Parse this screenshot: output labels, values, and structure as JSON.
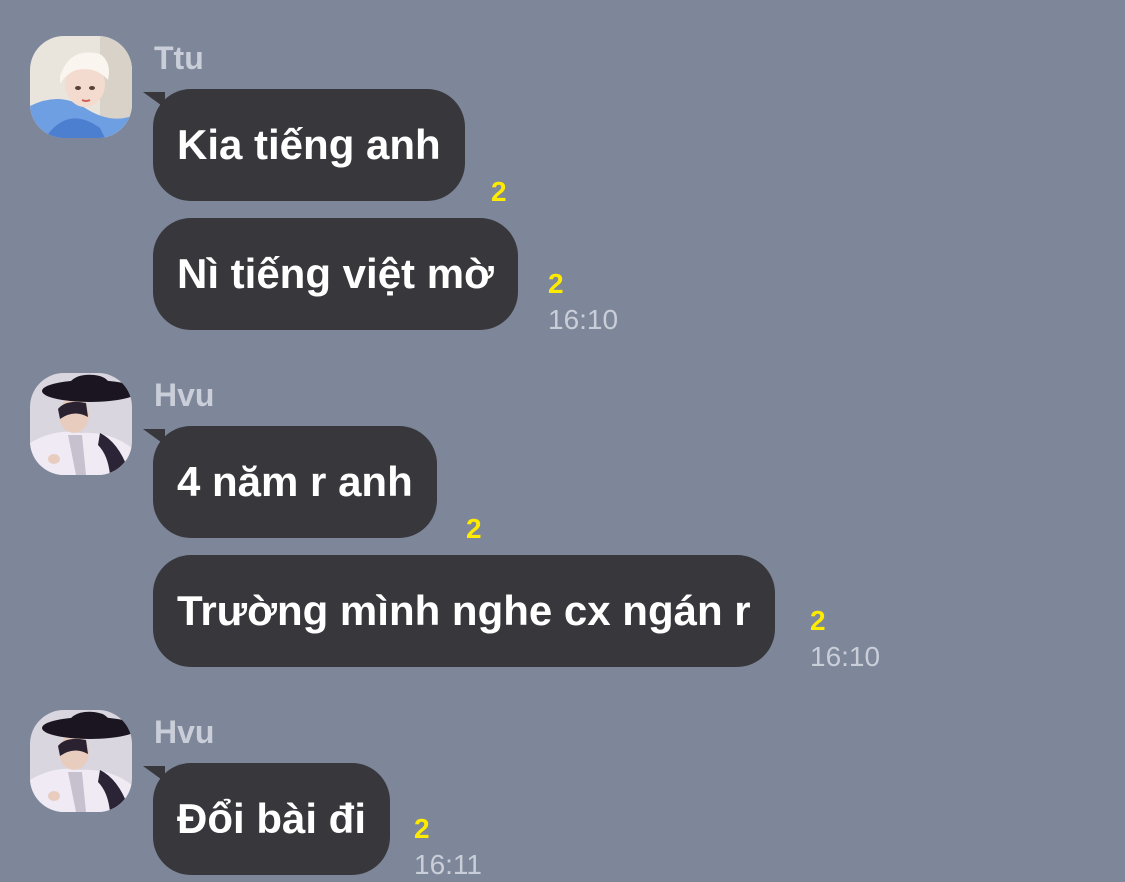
{
  "colors": {
    "background": "#7d8799",
    "bubble": "#38383c",
    "bubble_text": "#ffffff",
    "read_count": "#ffeb00",
    "meta_text": "#c9ced8"
  },
  "groups": [
    {
      "sender": "Ttu",
      "avatar": "avatar-ttu",
      "messages": [
        {
          "text": "Kia tiếng anh",
          "unread": "2"
        },
        {
          "text": "Nì tiếng việt mờ",
          "unread": "2"
        }
      ],
      "time": "16:10"
    },
    {
      "sender": "Hvu",
      "avatar": "avatar-hvu",
      "messages": [
        {
          "text": "4 năm r anh",
          "unread": "2"
        },
        {
          "text": "Trường mình nghe cx ngán r",
          "unread": "2"
        }
      ],
      "time": "16:10"
    },
    {
      "sender": "Hvu",
      "avatar": "avatar-hvu",
      "messages": [
        {
          "text": "Đổi bài đi",
          "unread": "2"
        }
      ],
      "time": "16:11"
    }
  ]
}
